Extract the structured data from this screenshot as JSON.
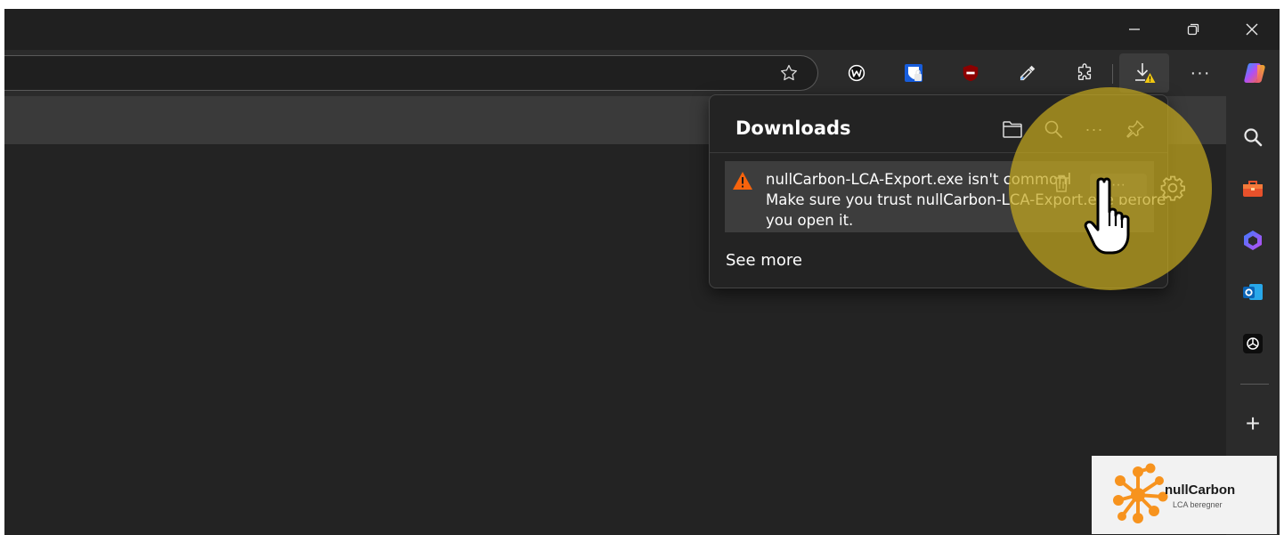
{
  "window": {
    "minimize_label": "—",
    "restore_label": "❐",
    "close_label": "✕"
  },
  "toolbar": {
    "favorite_icon": "star-icon",
    "extensions": [
      "w-extension-icon",
      "bitwarden-icon",
      "ublock-shield-icon",
      "eyedropper-icon",
      "extensions-puzzle-icon"
    ],
    "downloads_icon": "download-warning-icon",
    "more_label": "···",
    "copilot_icon": "copilot-icon"
  },
  "downloads": {
    "title": "Downloads",
    "header_icons": [
      "open-folder-icon",
      "search-icon",
      "more-icon",
      "pin-icon"
    ],
    "more_label": "···",
    "item": {
      "line1": "nullCarbon-LCA-Export.exe isn't commonl",
      "line2": "Make sure you trust nullCarbon-LCA-Export.exe before",
      "line3": "you open it.",
      "warning_color": "#f7630c",
      "actions_label": "···"
    },
    "see_more": "See more"
  },
  "sidebar": {
    "icons": [
      "search-icon",
      "toolbox-icon",
      "copilot-icon",
      "outlook-icon",
      "chatgpt-icon"
    ],
    "add_label": "+"
  },
  "logo": {
    "name": "nullCarbon",
    "tagline": "LCA beregner",
    "brand_color": "#f7931e"
  },
  "colors": {
    "background": "#202020",
    "panel": "#232323",
    "highlight": "#c4a81e"
  }
}
